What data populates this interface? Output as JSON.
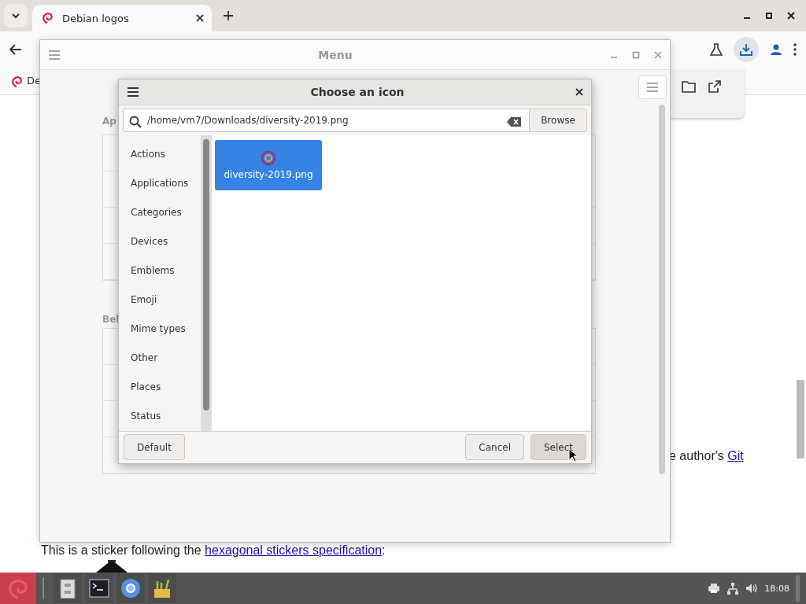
{
  "browser": {
    "tabs": [
      {
        "title": "Debian logos",
        "selected": true
      }
    ],
    "bookmarks": [
      {
        "label": "De"
      }
    ],
    "page": {
      "fragment": {
        "text": "e author's ",
        "link": "Git"
      },
      "sticker_line": {
        "before": "This is a sticker following the ",
        "link": "hexagonal stickers specification",
        "after": ":"
      }
    }
  },
  "menu_window": {
    "title": "Menu",
    "section_labels": [
      "Ap",
      "Bel"
    ]
  },
  "dialog": {
    "title": "Choose an icon",
    "path_field": {
      "value": "/home/vm7/Downloads/diversity-2019.png"
    },
    "browse_button": "Browse",
    "categories": [
      {
        "label": "Actions",
        "selected": false
      },
      {
        "label": "Applications",
        "selected": false
      },
      {
        "label": "Categories",
        "selected": false
      },
      {
        "label": "Devices",
        "selected": false
      },
      {
        "label": "Emblems",
        "selected": false
      },
      {
        "label": "Emoji",
        "selected": false
      },
      {
        "label": "Mime types",
        "selected": false
      },
      {
        "label": "Other",
        "selected": false
      },
      {
        "label": "Places",
        "selected": false
      },
      {
        "label": "Status",
        "selected": false
      }
    ],
    "icons": [
      {
        "label": "diversity-2019.png",
        "selected": true
      }
    ],
    "buttons": [
      {
        "label": "Default",
        "kind": "left"
      },
      {
        "label": "Cancel",
        "kind": "right"
      },
      {
        "label": "Select",
        "kind": "default"
      }
    ]
  },
  "taskbar": {
    "apps": [
      {
        "kind": "files"
      },
      {
        "kind": "terminal"
      },
      {
        "kind": "browser"
      },
      {
        "kind": "tools"
      }
    ],
    "clock": "18:08"
  }
}
